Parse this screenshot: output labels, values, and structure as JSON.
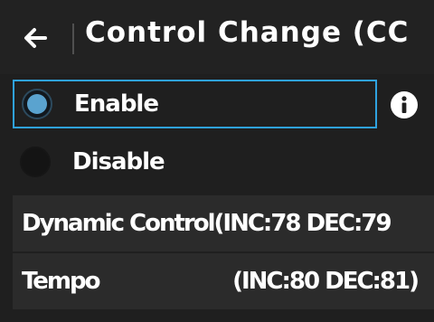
{
  "header": {
    "title": "Control Change (CC",
    "back_icon": "arrow-left-icon"
  },
  "options": {
    "selected": "Enable",
    "items": [
      {
        "label": "Enable",
        "checked": true
      },
      {
        "label": "Disable",
        "checked": false
      }
    ],
    "info_icon": "info-icon"
  },
  "list": {
    "items": [
      {
        "label": "Dynamic Control(INC:78 DEC:79",
        "value": ""
      },
      {
        "label": "Tempo",
        "value": "(INC:80 DEC:81)"
      }
    ]
  },
  "colors": {
    "accent": "#2fa2e0",
    "radio_fill": "#5aa3cf",
    "background": "#1f1f1f",
    "row_background": "#2b2b2b"
  }
}
